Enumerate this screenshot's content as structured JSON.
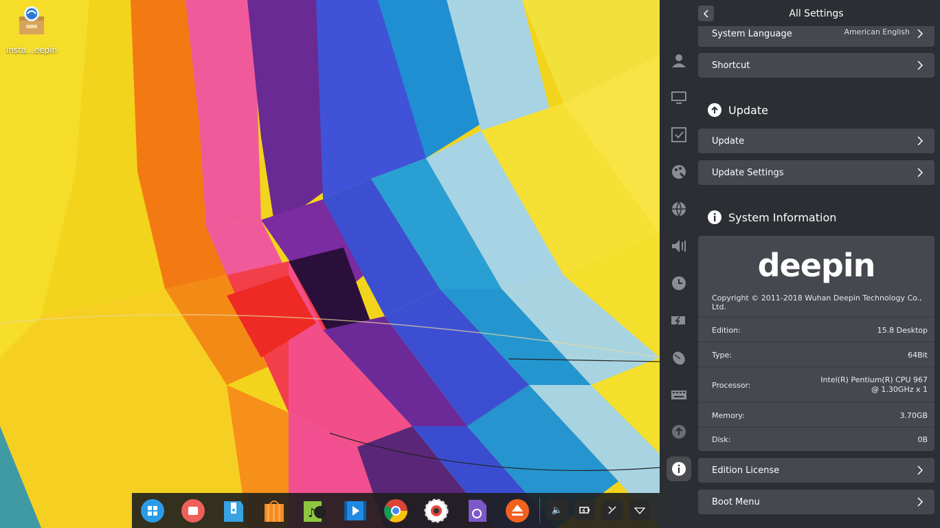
{
  "desktop": {
    "icon_label": "Insta...eepin"
  },
  "settings": {
    "title": "All Settings",
    "rows_top": {
      "language_label": "System Language",
      "language_value": "American English",
      "shortcut_label": "Shortcut"
    },
    "update_section": {
      "title": "Update",
      "update_label": "Update",
      "settings_label": "Update Settings"
    },
    "sysinfo_section": {
      "title": "System Information",
      "logo": "deepin",
      "copyright": "Copyright © 2011-2018 Wuhan Deepin Technology Co., Ltd.",
      "edition_label": "Edition:",
      "edition_value": "15.8 Desktop",
      "type_label": "Type:",
      "type_value": "64Bit",
      "processor_label": "Processor:",
      "processor_line1": "Intel(R) Pentium(R) CPU 967",
      "processor_line2": "@ 1.30GHz x 1",
      "memory_label": "Memory:",
      "memory_value": "3.70GB",
      "disk_label": "Disk:",
      "disk_value": "0B"
    },
    "rows_bottom": {
      "license_label": "Edition License",
      "boot_label": "Boot Menu"
    }
  },
  "nav_icons": [
    "account-icon",
    "display-icon",
    "default-apps-icon",
    "personalization-icon",
    "network-icon",
    "sound-icon",
    "time-icon",
    "power-icon",
    "mouse-icon",
    "keyboard-icon",
    "update-icon",
    "info-icon"
  ],
  "dock_apps": [
    "launcher-icon",
    "multitasking-icon",
    "file-manager-icon",
    "app-store-icon",
    "music-icon",
    "movie-icon",
    "chrome-icon",
    "control-center-icon",
    "system-monitor-icon",
    "eject-icon"
  ],
  "colors": {
    "panel_bg": "#2b2e33",
    "row_bg": "#45484f"
  }
}
